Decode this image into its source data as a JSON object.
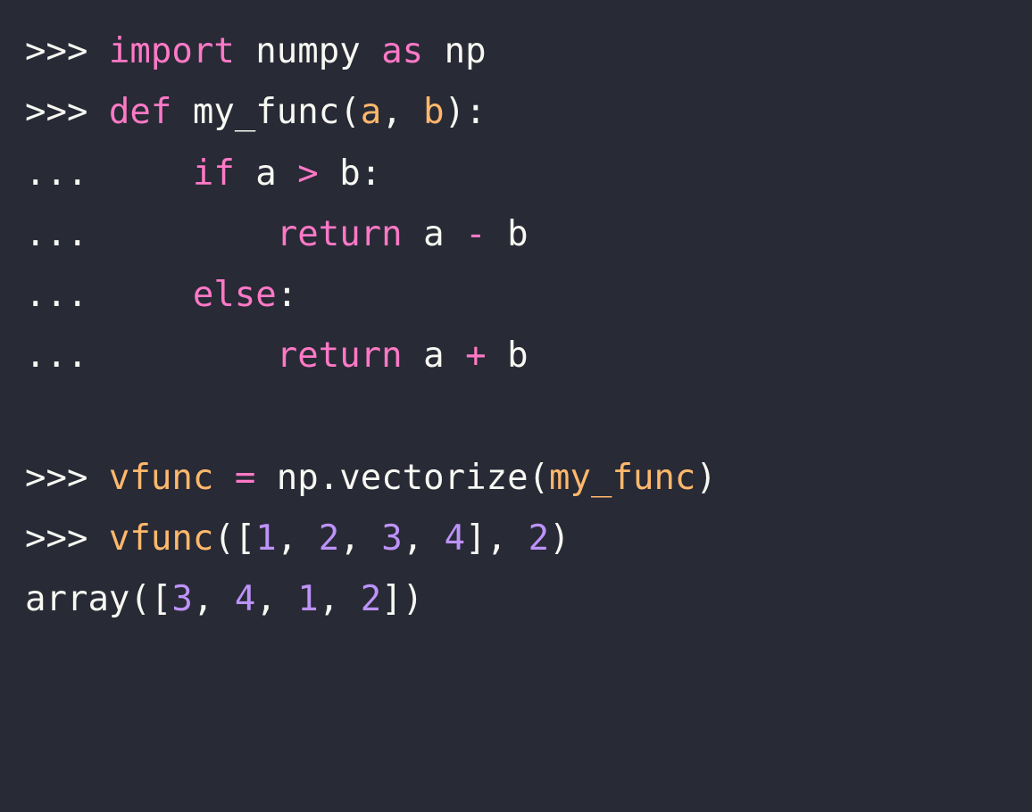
{
  "colors": {
    "background": "#282a36",
    "default": "#f8f8f2",
    "keyword": "#ff79c6",
    "builtin": "#8be9fd",
    "param": "#ffb86c",
    "number": "#bd93f9"
  },
  "code": {
    "lines": [
      {
        "tokens": [
          {
            "cls": "tok-prompt",
            "text": ">>> "
          },
          {
            "cls": "tok-keyword",
            "text": "import"
          },
          {
            "cls": "tok-plain",
            "text": " numpy "
          },
          {
            "cls": "tok-keyword",
            "text": "as"
          },
          {
            "cls": "tok-plain",
            "text": " np"
          }
        ]
      },
      {
        "tokens": [
          {
            "cls": "tok-prompt",
            "text": ">>> "
          },
          {
            "cls": "tok-keyword",
            "text": "def"
          },
          {
            "cls": "tok-plain",
            "text": " "
          },
          {
            "cls": "tok-funcname",
            "text": "my_func"
          },
          {
            "cls": "tok-punct",
            "text": "("
          },
          {
            "cls": "tok-param",
            "text": "a"
          },
          {
            "cls": "tok-punct",
            "text": ", "
          },
          {
            "cls": "tok-param",
            "text": "b"
          },
          {
            "cls": "tok-punct",
            "text": "):"
          }
        ]
      },
      {
        "tokens": [
          {
            "cls": "tok-prompt",
            "text": "...     "
          },
          {
            "cls": "tok-keyword",
            "text": "if"
          },
          {
            "cls": "tok-plain",
            "text": " a "
          },
          {
            "cls": "tok-operator",
            "text": ">"
          },
          {
            "cls": "tok-plain",
            "text": " b"
          },
          {
            "cls": "tok-punct",
            "text": ":"
          }
        ]
      },
      {
        "tokens": [
          {
            "cls": "tok-prompt",
            "text": "...         "
          },
          {
            "cls": "tok-keyword",
            "text": "return"
          },
          {
            "cls": "tok-plain",
            "text": " a "
          },
          {
            "cls": "tok-operator",
            "text": "-"
          },
          {
            "cls": "tok-plain",
            "text": " b"
          }
        ]
      },
      {
        "tokens": [
          {
            "cls": "tok-prompt",
            "text": "...     "
          },
          {
            "cls": "tok-keyword",
            "text": "else"
          },
          {
            "cls": "tok-punct",
            "text": ":"
          }
        ]
      },
      {
        "tokens": [
          {
            "cls": "tok-prompt",
            "text": "...         "
          },
          {
            "cls": "tok-keyword",
            "text": "return"
          },
          {
            "cls": "tok-plain",
            "text": " a "
          },
          {
            "cls": "tok-operator",
            "text": "+"
          },
          {
            "cls": "tok-plain",
            "text": " b"
          }
        ]
      },
      {
        "tokens": [
          {
            "cls": "tok-plain",
            "text": " "
          }
        ]
      },
      {
        "tokens": [
          {
            "cls": "tok-prompt",
            "text": ">>> "
          },
          {
            "cls": "tok-ident",
            "text": "vfunc"
          },
          {
            "cls": "tok-plain",
            "text": " "
          },
          {
            "cls": "tok-operator",
            "text": "="
          },
          {
            "cls": "tok-plain",
            "text": " np"
          },
          {
            "cls": "tok-punct",
            "text": "."
          },
          {
            "cls": "tok-plain",
            "text": "vectorize"
          },
          {
            "cls": "tok-punct",
            "text": "("
          },
          {
            "cls": "tok-ident",
            "text": "my_func"
          },
          {
            "cls": "tok-punct",
            "text": ")"
          }
        ]
      },
      {
        "tokens": [
          {
            "cls": "tok-prompt",
            "text": ">>> "
          },
          {
            "cls": "tok-ident",
            "text": "vfunc"
          },
          {
            "cls": "tok-punct",
            "text": "(["
          },
          {
            "cls": "tok-number",
            "text": "1"
          },
          {
            "cls": "tok-punct",
            "text": ", "
          },
          {
            "cls": "tok-number",
            "text": "2"
          },
          {
            "cls": "tok-punct",
            "text": ", "
          },
          {
            "cls": "tok-number",
            "text": "3"
          },
          {
            "cls": "tok-punct",
            "text": ", "
          },
          {
            "cls": "tok-number",
            "text": "4"
          },
          {
            "cls": "tok-punct",
            "text": "], "
          },
          {
            "cls": "tok-number",
            "text": "2"
          },
          {
            "cls": "tok-punct",
            "text": ")"
          }
        ]
      },
      {
        "tokens": [
          {
            "cls": "tok-plain",
            "text": "array"
          },
          {
            "cls": "tok-punct",
            "text": "(["
          },
          {
            "cls": "tok-number",
            "text": "3"
          },
          {
            "cls": "tok-punct",
            "text": ", "
          },
          {
            "cls": "tok-number",
            "text": "4"
          },
          {
            "cls": "tok-punct",
            "text": ", "
          },
          {
            "cls": "tok-number",
            "text": "1"
          },
          {
            "cls": "tok-punct",
            "text": ", "
          },
          {
            "cls": "tok-number",
            "text": "2"
          },
          {
            "cls": "tok-punct",
            "text": "])"
          }
        ]
      }
    ]
  }
}
